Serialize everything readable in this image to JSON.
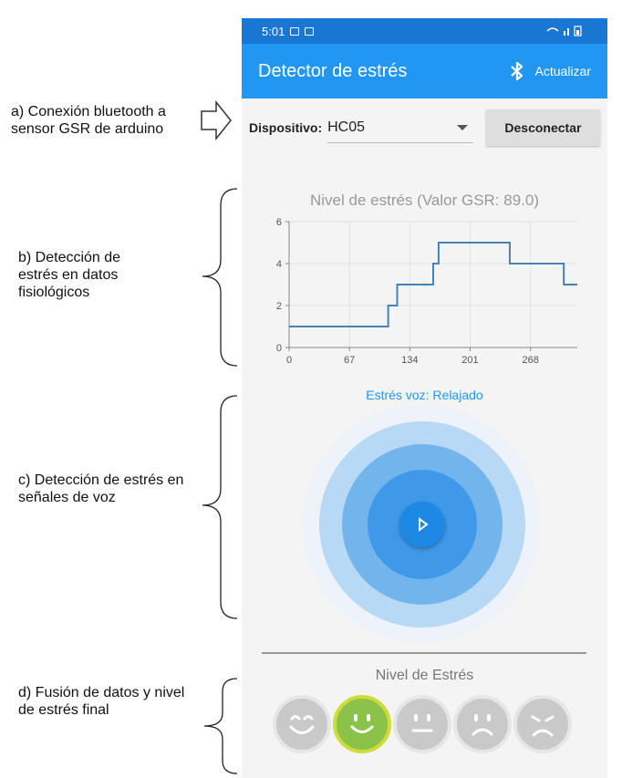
{
  "annotations": {
    "a": "a) Conexión bluetooth a sensor GSR de arduino",
    "b": "b) Detección de estrés en datos fisiológicos",
    "c": "c) Detección de estrés en señales de voz",
    "d": "d) Fusión de datos y nivel de estrés final"
  },
  "status": {
    "time": "5:01"
  },
  "appbar": {
    "title": "Detector de estrés",
    "refresh_label": "Actualizar"
  },
  "device": {
    "label": "Dispositivo:",
    "selected": "HC05",
    "disconnect_label": "Desconectar"
  },
  "chart_data": {
    "type": "line",
    "title": "Nivel de estrés (Valor GSR: 89.0)",
    "xlabel": "",
    "ylabel": "",
    "xlim": [
      0,
      320
    ],
    "ylim": [
      0,
      6
    ],
    "x_ticks": [
      0,
      67,
      134,
      201,
      268
    ],
    "y_ticks": [
      0,
      2,
      4,
      6
    ],
    "grid": true,
    "color": "#4682b4",
    "step": true,
    "x": [
      0,
      110,
      110,
      120,
      120,
      160,
      160,
      166,
      166,
      245,
      245,
      305,
      305,
      320
    ],
    "y": [
      1,
      1,
      2,
      2,
      3,
      3,
      4,
      4,
      5,
      5,
      4,
      4,
      3,
      3
    ]
  },
  "voice": {
    "label": "Estrés voz: Relajado",
    "play_icon": "play-icon"
  },
  "level": {
    "label": "Nivel de Estrés",
    "faces": [
      {
        "name": "face-very-happy",
        "mood": "very-happy",
        "selected": false
      },
      {
        "name": "face-happy",
        "mood": "happy",
        "selected": true
      },
      {
        "name": "face-neutral",
        "mood": "neutral",
        "selected": false
      },
      {
        "name": "face-sad",
        "mood": "sad",
        "selected": false
      },
      {
        "name": "face-very-sad",
        "mood": "very-sad",
        "selected": false
      }
    ]
  },
  "colors": {
    "primary": "#2196f3",
    "primary_dark": "#1976d2",
    "selected_face": "#8bc34a",
    "chart_line": "#4682b4"
  }
}
